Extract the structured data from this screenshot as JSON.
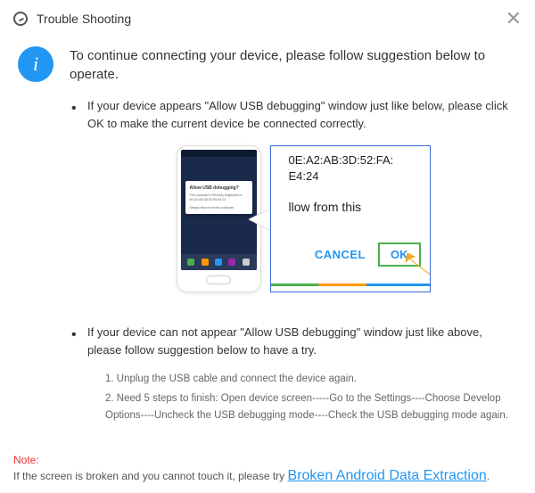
{
  "header": {
    "title": "Trouble Shooting"
  },
  "intro": "To continue connecting your device, please follow suggestion below to operate.",
  "bullet1": "If your device appears \"Allow USB debugging\" window just like below, please click OK to make the current device  be connected correctly.",
  "bullet2": "If your device can not appear \"Allow USB debugging\" window just like above, please follow suggestion below to have a try.",
  "phone": {
    "popupTitle": "Allow USB debugging?",
    "popupBody": "The computer's RSA key fingerprint is: 0E:A2:AB:3D:52:FA:E4:24",
    "popupCheck": "Always allow from this computer"
  },
  "zoom": {
    "line1": "0E:A2:AB:3D:52:FA:",
    "line2": "E4:24",
    "line3": "llow from this",
    "cancel": "CANCEL",
    "ok": "OK"
  },
  "steps": {
    "s1": "1. Unplug the USB cable and connect the device again.",
    "s2": "2. Need 5 steps to finish: Open device screen-----Go to the Settings----Choose Develop Options----Uncheck the USB debugging mode----Check the USB debugging mode again."
  },
  "footer": {
    "noteLabel": "Note:",
    "noteText": "If the screen is broken and you cannot touch it, please try ",
    "noteLink": "Broken Android Data Extraction"
  }
}
